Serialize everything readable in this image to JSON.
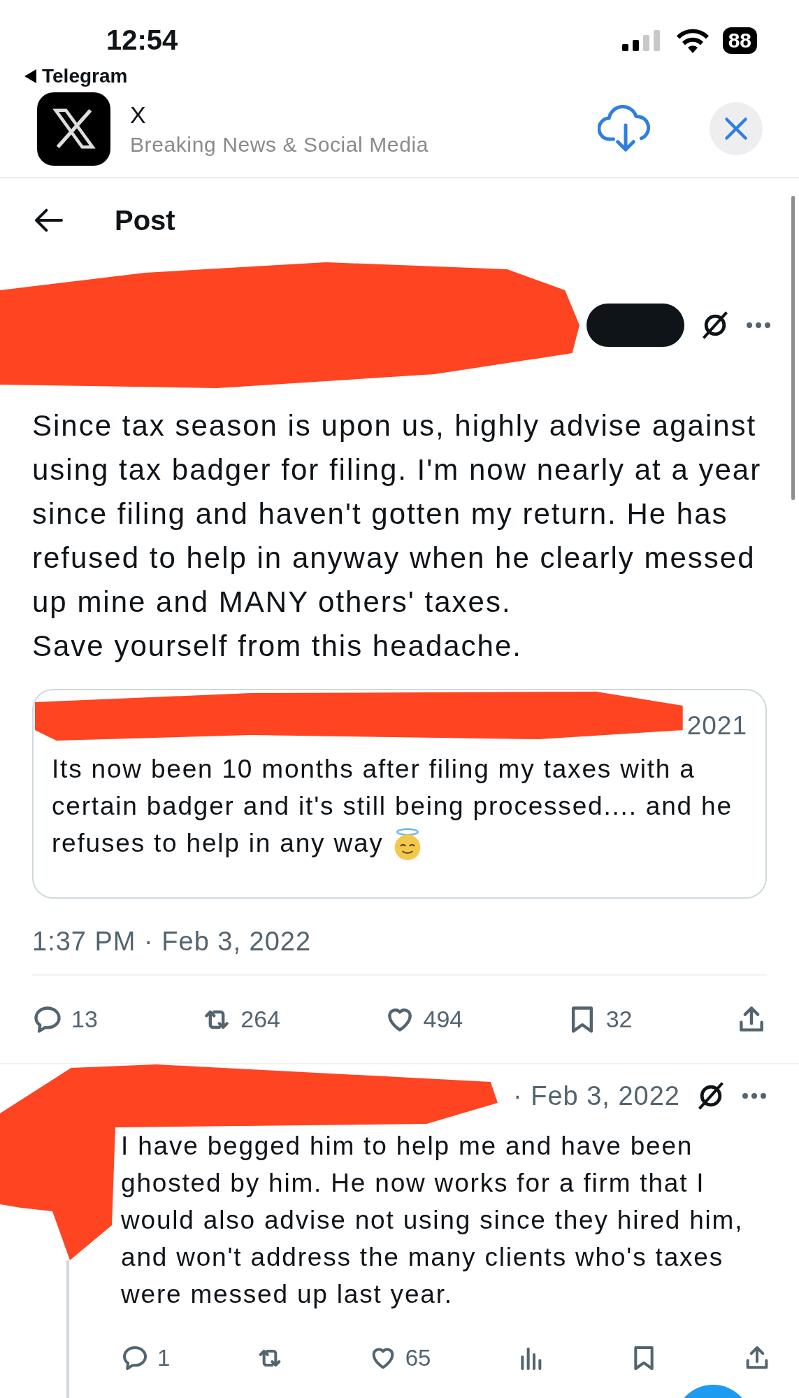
{
  "status_bar": {
    "time": "12:54",
    "back_app": "Telegram",
    "battery": "88"
  },
  "banner": {
    "app_name": "X",
    "subtitle": "Breaking News & Social Media"
  },
  "header": {
    "title": "Post"
  },
  "post": {
    "text": "Since tax season is upon us, highly advise against\nusing tax badger for filing. I'm now nearly at a year\nsince filing and haven't gotten my return. He has\nrefused to help in anyway when he clearly messed\nup mine and MANY others' taxes.\nSave yourself from this headache.",
    "quote": {
      "date_fragment": "2021",
      "text": "Its now been 10 months after filing my taxes with a\ncertain badger and it's still being processed.... and he\nrefuses to help in any way"
    },
    "timestamp": "1:37 PM · Feb 3, 2022",
    "actions": [
      {
        "kind": "reply",
        "count": "13"
      },
      {
        "kind": "repost",
        "count": "264"
      },
      {
        "kind": "like",
        "count": "494"
      },
      {
        "kind": "bookmark",
        "count": "32"
      },
      {
        "kind": "share"
      }
    ]
  },
  "reply": {
    "date": "· Feb 3, 2022",
    "text": "I have begged him to help me and have been\nghosted by him. He now works for a firm that I\nwould also advise not using since they hired him,\nand won't address the many clients who's taxes\nwere messed up last year.",
    "actions": [
      {
        "kind": "reply",
        "count": "1"
      },
      {
        "kind": "repost"
      },
      {
        "kind": "like",
        "count": "65"
      },
      {
        "kind": "views"
      },
      {
        "kind": "bookmark"
      },
      {
        "kind": "share"
      }
    ]
  }
}
